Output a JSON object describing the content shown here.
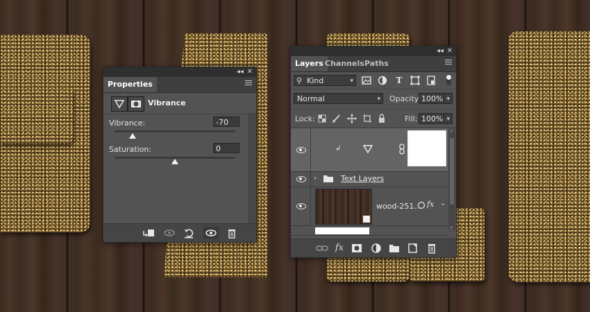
{
  "properties": {
    "tab": "Properties",
    "title": "Vibrance",
    "vibrance_label": "Vibrance:",
    "vibrance_value": "-70",
    "vibrance_level": -70,
    "saturation_label": "Saturation:",
    "saturation_value": "0",
    "saturation_level": 0
  },
  "layers": {
    "tabs": [
      "Layers",
      "Channels",
      "Paths"
    ],
    "filter_kind": "Kind",
    "blend_mode": "Normal",
    "opacity_label": "Opacity:",
    "opacity_value": "100%",
    "lock_label": "Lock:",
    "fill_label": "Fill:",
    "fill_value": "100%",
    "group_name": "Text Layers",
    "wood_layer_name": "wood-251..."
  },
  "colors": {
    "panel": "#535353",
    "panel_dark": "#454545",
    "selected_row": "#646464",
    "text": "#dcdcdc"
  }
}
